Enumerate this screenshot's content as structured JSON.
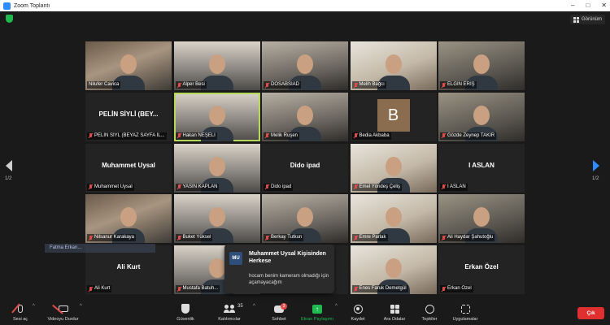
{
  "window": {
    "title": "Zoom Toplantı"
  },
  "topbar": {
    "view_label": "Görünüm"
  },
  "pagination": {
    "left": "1/2",
    "right": "1/2"
  },
  "participants": [
    {
      "label": "Nilufer Cavica",
      "muted": false,
      "type": "video"
    },
    {
      "label": "Alper Besi",
      "muted": true,
      "type": "video"
    },
    {
      "label": "DOSABSİAD",
      "muted": true,
      "type": "video"
    },
    {
      "label": "Melih Bağcı",
      "muted": true,
      "type": "video"
    },
    {
      "label": "ELGİN ERİŞ",
      "muted": true,
      "type": "video"
    },
    {
      "label": "PELİN SİYL (BEYAZ SAYFA İL...",
      "muted": true,
      "type": "name",
      "name": "PELİN SİYLİ (BEY..."
    },
    {
      "label": "Hakan NEŞELİ",
      "muted": true,
      "type": "video",
      "active": true
    },
    {
      "label": "Melik Ruşen",
      "muted": true,
      "type": "video"
    },
    {
      "label": "Bedia Akbaba",
      "muted": true,
      "type": "avatar",
      "initial": "B"
    },
    {
      "label": "Gözde Zeynep TAKIR",
      "muted": true,
      "type": "video"
    },
    {
      "label": "Muhammet Uysal",
      "muted": true,
      "type": "name",
      "name": "Muhammet Uysal"
    },
    {
      "label": "YASİN KAPLAN",
      "muted": true,
      "type": "video"
    },
    {
      "label": "Dido ipad",
      "muted": true,
      "type": "name",
      "name": "Dido ipad"
    },
    {
      "label": "Emel Yöndeş Çeliş",
      "muted": true,
      "type": "video"
    },
    {
      "label": "I ASLAN",
      "muted": true,
      "type": "name",
      "name": "I ASLAN"
    },
    {
      "label": "Nilsanur Karakaya",
      "muted": true,
      "type": "video"
    },
    {
      "label": "Buket Yüksel",
      "muted": true,
      "type": "video"
    },
    {
      "label": "Berkay Tutkun",
      "muted": true,
      "type": "video"
    },
    {
      "label": "Emre Parlak",
      "muted": true,
      "type": "video"
    },
    {
      "label": "Ali Haydar Şahutoğlu",
      "muted": true,
      "type": "video"
    },
    {
      "label": "Ali Kurt",
      "muted": true,
      "type": "name",
      "name": "Ali Kurt"
    },
    {
      "label": "Mustafa Batuh...",
      "muted": true,
      "type": "video"
    },
    {
      "label": "",
      "muted": false,
      "type": "empty"
    },
    {
      "label": "Enes Faruk Demetgül",
      "muted": true,
      "type": "video"
    },
    {
      "label": "Erkan Özel",
      "muted": true,
      "type": "name",
      "name": "Erkan Özel"
    }
  ],
  "muted_bar": {
    "text": "Fatma Erkan..."
  },
  "chat_popup": {
    "avatar": "MU",
    "header": "Muhammet Uysal Kişisinden Herkese",
    "message": "hocam benim kameram olmadığı için açamayacağım"
  },
  "toolbar": {
    "audio": "Sesi aç",
    "video": "Videoyu Durdur",
    "security": "Güvenlik",
    "participants": "Katılımcılar",
    "participants_count": "35",
    "chat": "Sohbet",
    "chat_badge": "3",
    "share": "Ekran Paylaşımı",
    "record": "Kaydet",
    "rooms": "Ara Odalar",
    "reactions": "Tepkiler",
    "apps": "Uygulamalar",
    "leave": "Çık"
  }
}
